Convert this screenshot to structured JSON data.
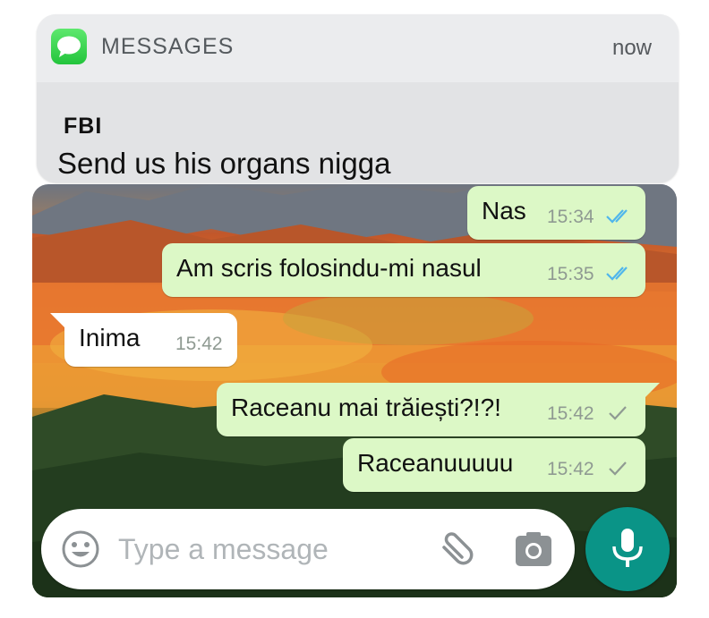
{
  "notification": {
    "app_name": "MESSAGES",
    "time": "now",
    "sender": "FBI",
    "message": "Send us his organs nigga",
    "app_icon": "messages-app-icon"
  },
  "chat": {
    "messages": [
      {
        "direction": "out",
        "text": "Nas",
        "time": "15:34",
        "status": "read"
      },
      {
        "direction": "out",
        "text": "Am scris folosindu-mi nasul",
        "time": "15:35",
        "status": "read"
      },
      {
        "direction": "in",
        "text": "Inima",
        "time": "15:42"
      },
      {
        "direction": "out",
        "text": "Raceanu mai trăiești?!?!",
        "time": "15:42",
        "status": "sent"
      },
      {
        "direction": "out",
        "text": "Raceanuuuuu",
        "time": "15:42",
        "status": "sent"
      }
    ]
  },
  "composer": {
    "placeholder": "Type a message",
    "emoji_icon": "emoji-icon",
    "attach_icon": "paperclip-icon",
    "camera_icon": "camera-icon",
    "mic_icon": "microphone-icon"
  },
  "colors": {
    "outgoing_bubble": "#dcf8c6",
    "incoming_bubble": "#ffffff",
    "read_ticks": "#4fb6ec",
    "sent_ticks": "#8f9a92",
    "mic_button": "#0a9487"
  }
}
